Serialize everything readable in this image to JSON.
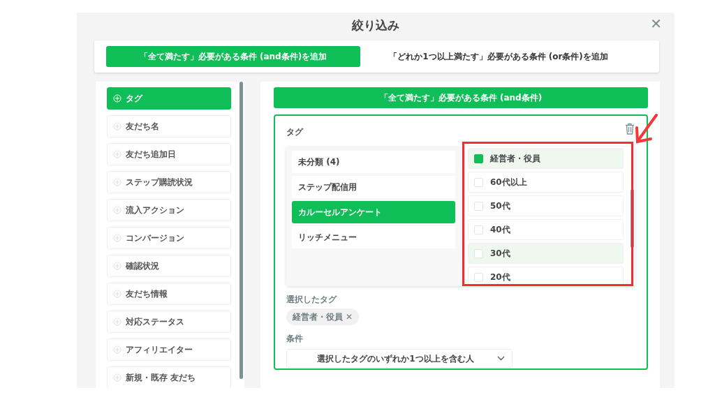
{
  "dialog": {
    "title": "絞り込み",
    "close": "✕"
  },
  "mode_tabs": [
    {
      "label": "「全て満たす」必要がある条件 (and条件)を追加",
      "selected": true
    },
    {
      "label": "「どれか1つ以上満たす」必要がある条件 (or条件)を追加",
      "selected": false
    }
  ],
  "sidebar": {
    "items": [
      {
        "label": "タグ",
        "selected": true
      },
      {
        "label": "友だち名",
        "selected": false
      },
      {
        "label": "友だち追加日",
        "selected": false
      },
      {
        "label": "ステップ購読状況",
        "selected": false
      },
      {
        "label": "流入アクション",
        "selected": false
      },
      {
        "label": "コンバージョン",
        "selected": false
      },
      {
        "label": "確認状況",
        "selected": false
      },
      {
        "label": "友だち情報",
        "selected": false
      },
      {
        "label": "対応ステータス",
        "selected": false
      },
      {
        "label": "アフィリエイター",
        "selected": false
      },
      {
        "label": "新規・既存 友だち",
        "selected": false
      }
    ]
  },
  "condition_group": {
    "header": "「全て満たす」必要がある条件 (and条件)",
    "condition": {
      "title": "タグ",
      "folders": [
        {
          "label": "未分類 (4)",
          "selected": false
        },
        {
          "label": "ステップ配信用",
          "selected": false
        },
        {
          "label": "カルーセルアンケート",
          "selected": true
        },
        {
          "label": "リッチメニュー",
          "selected": false
        }
      ],
      "tags": [
        {
          "label": "経営者・役員",
          "checked": true,
          "highlighted": true
        },
        {
          "label": "60代以上",
          "checked": false,
          "highlighted": false
        },
        {
          "label": "50代",
          "checked": false,
          "highlighted": false
        },
        {
          "label": "40代",
          "checked": false,
          "highlighted": false
        },
        {
          "label": "30代",
          "checked": false,
          "highlighted": true
        },
        {
          "label": "20代",
          "checked": false,
          "highlighted": false
        }
      ],
      "selected_label": "選択したタグ",
      "selected_tags": [
        {
          "label": "経営者・役員",
          "remove": "✕"
        }
      ],
      "match_label": "条件",
      "match_value": "選択したタグのいずれか1つ以上を含む人"
    }
  }
}
